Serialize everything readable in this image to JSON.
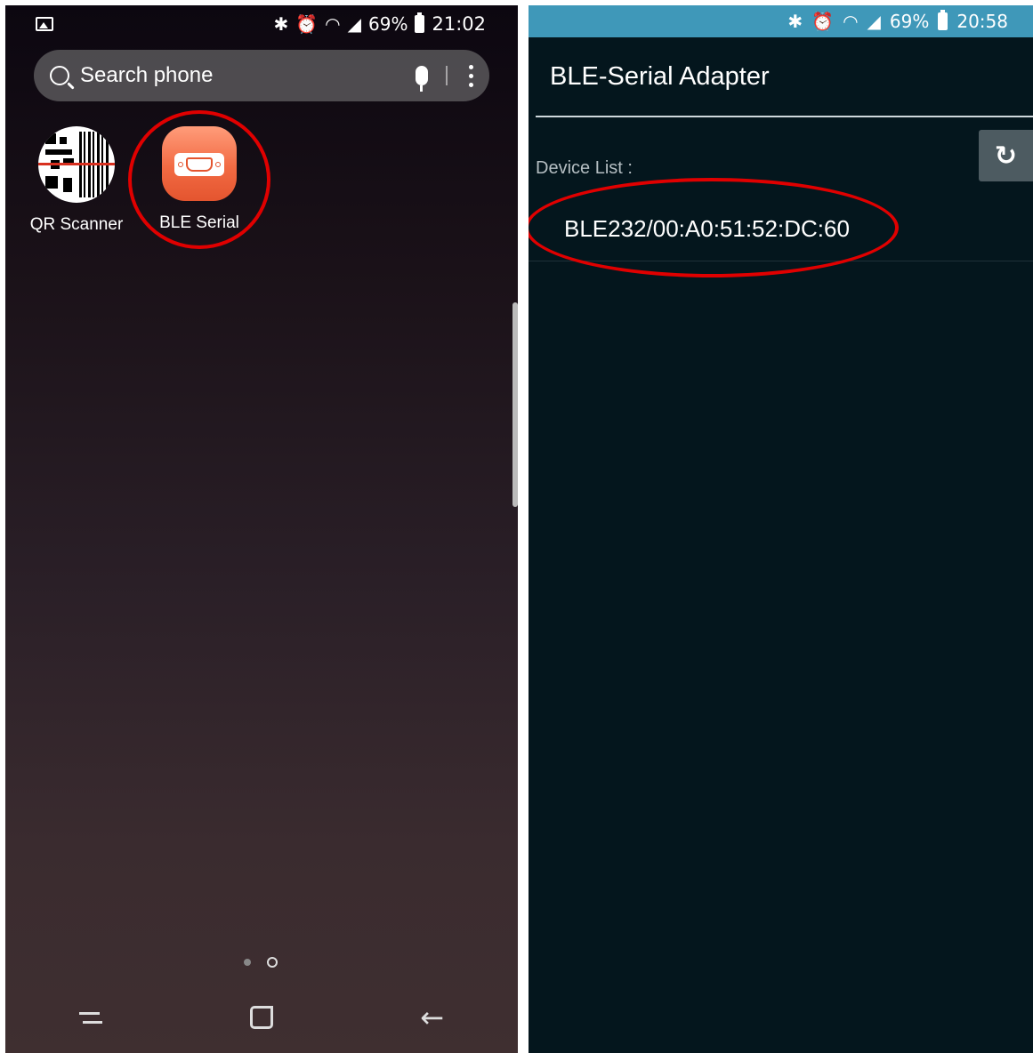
{
  "left_screen": {
    "status_bar": {
      "percent": "69%",
      "time": "21:02"
    },
    "search": {
      "placeholder": "Search phone"
    },
    "apps": [
      {
        "label": "QR Scanner",
        "icon": "qr-scanner-icon"
      },
      {
        "label": "BLE Serial",
        "icon": "db9-serial-icon"
      }
    ],
    "page_indicator": {
      "pages": 2,
      "current": 2
    }
  },
  "right_screen": {
    "status_bar": {
      "percent": "69%",
      "time": "20:58",
      "color": "#3f98b9"
    },
    "title": "BLE-Serial Adapter",
    "device_list_label": "Device List :",
    "devices": [
      {
        "name": "BLE232/00:A0:51:52:DC:60"
      }
    ]
  },
  "annotation_color": "#e00000"
}
